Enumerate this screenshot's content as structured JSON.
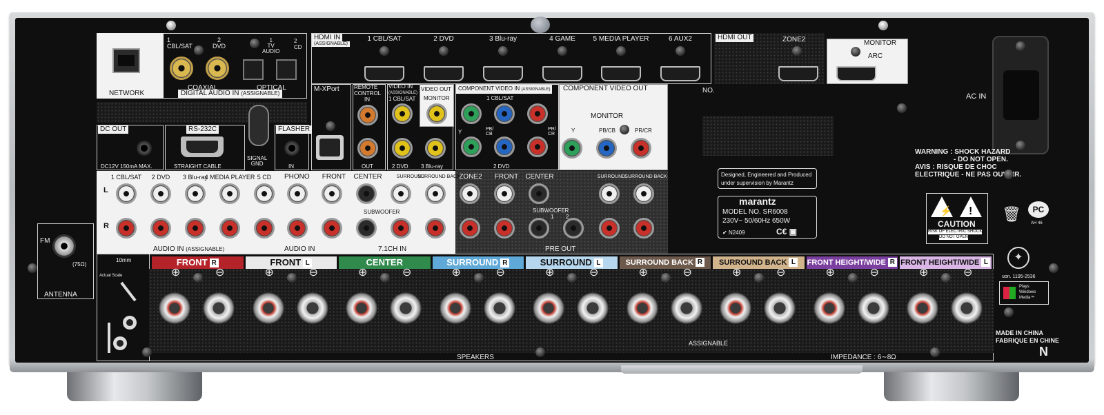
{
  "panel": {
    "network": "NETWORK",
    "digital_audio": {
      "coaxial_1": "1\nCBL/SAT",
      "coaxial_1_a": "1",
      "coaxial_1_b": "CBL/SAT",
      "coaxial_2_a": "2",
      "coaxial_2_b": "DVD",
      "optical_1_a": "1",
      "optical_1_b": "TV",
      "optical_1_c": "AUDIO",
      "optical_2_a": "2",
      "optical_2_b": "CD",
      "coaxial": "COAXIAL",
      "optical": "OPTICAL",
      "title": "DIGITAL AUDIO IN",
      "assignable": "(ASSIGNABLE)"
    },
    "hdmi_in": {
      "title": "HDMI IN",
      "assignable": "(ASSIGNABLE)",
      "inputs": [
        "1 CBL/SAT",
        "2 DVD",
        "3 Blu-ray",
        "4 GAME",
        "5 MEDIA PLAYER",
        "6 AUX2"
      ]
    },
    "hdmi_out": {
      "title": "HDMI OUT",
      "zone2": "ZONE2",
      "monitor": "MONITOR",
      "arc": "ARC",
      "no": "NO."
    },
    "ac_in": "AC IN",
    "m_xport": "M-XPort",
    "remote_control": {
      "title_a": "REMOTE",
      "title_b": "CONTROL",
      "in": "IN",
      "out": "OUT"
    },
    "video_in": {
      "title_a": "VIDEO IN",
      "title_b": "(ASSIGNABLE)",
      "cbl": "1 CBL/SAT",
      "dvd": "2 DVD",
      "bluray": "3 Blu-ray"
    },
    "video_out": {
      "title": "VIDEO OUT",
      "monitor": "MONITOR"
    },
    "component_in": {
      "title": "COMPONENT VIDEO IN",
      "assignable": "(ASSIGNABLE)",
      "cbl": "1 CBL/SAT",
      "dvd": "2 DVD",
      "y": "Y",
      "pb": "PB/\nCB",
      "pb_a": "PB/",
      "pb_b": "CB",
      "pr_a": "PR/",
      "pr_b": "CR"
    },
    "component_out": {
      "title": "COMPONENT VIDEO OUT",
      "monitor": "MONITOR",
      "y": "Y",
      "pb": "PB/CB",
      "pr": "PR/CR"
    },
    "dc_out": {
      "title": "DC OUT",
      "spec": "DC12V 150mA MAX."
    },
    "rs232c": {
      "title": "RS-232C",
      "cable": "STRAIGHT CABLE"
    },
    "signal_gnd_a": "SIGNAL",
    "signal_gnd_b": "GND",
    "flasher": {
      "title": "FLASHER",
      "in": "IN"
    },
    "audio_in": {
      "labels": [
        "1 CBL/SAT",
        "2 DVD",
        "3 Blu-ray",
        "4 MEDIA PLAYER",
        "5 CD"
      ],
      "title": "AUDIO IN",
      "assignable": "(ASSIGNABLE)",
      "l": "L",
      "r": "R"
    },
    "phono": {
      "title": "PHONO",
      "footer": "AUDIO IN"
    },
    "multi_in": {
      "labels": [
        "FRONT",
        "CENTER",
        "SURROUND",
        "SURROUND BACK"
      ],
      "subwoofer": "SUBWOOFER",
      "footer": "7.1CH IN"
    },
    "pre_out": {
      "labels": [
        "ZONE2",
        "FRONT",
        "CENTER",
        "SURROUND",
        "SURROUND BACK"
      ],
      "subwoofer": "SUBWOOFER",
      "sub_1": "1",
      "sub_2": "2",
      "footer": "PRE OUT"
    },
    "designed": {
      "line1": "Designed, Engineered and Produced",
      "line2": "under supervision by Marantz"
    },
    "model": {
      "brand": "marantz",
      "model": "MODEL NO. SR6008",
      "power": "230V~ 50/60Hz 650W",
      "cert": "N2409"
    },
    "warning": {
      "l1": "WARNING : SHOCK HAZARD",
      "l2": "- DO NOT OPEN.",
      "l3": "AVIS : RISQUE DE CHOC",
      "l4": "ELECTRIQUE - NE PAS OUVRIR."
    },
    "caution": {
      "title": "CAUTION",
      "l1": "RISK OF ELECTRIC SHOCK",
      "l2": "DO NOT OPEN"
    },
    "pct_small": "AH 46",
    "cert_number": "uon. 1195-2536",
    "windows": {
      "a": "Plays",
      "b": "Windows",
      "c": "Media™"
    },
    "made_in": {
      "l1": "MADE IN CHINA",
      "l2": "FABRIQUE EN CHINE"
    },
    "antenna": {
      "fm": "FM",
      "ohm": "(75Ω)",
      "title": "ANTENNA"
    },
    "scale": {
      "mm": "10mm",
      "actual": "Actual Scale"
    },
    "speakers": {
      "bands": [
        {
          "label": "FRONT",
          "ch": "R"
        },
        {
          "label": "FRONT",
          "ch": "L"
        },
        {
          "label": "CENTER",
          "ch": ""
        },
        {
          "label": "SURROUND",
          "ch": "R"
        },
        {
          "label": "SURROUND",
          "ch": "L"
        },
        {
          "label": "SURROUND BACK",
          "ch": "R"
        },
        {
          "label": "SURROUND BACK",
          "ch": "L"
        },
        {
          "label": "FRONT HEIGHT/WIDE",
          "ch": "R"
        },
        {
          "label": "FRONT HEIGHT/WIDE",
          "ch": "L"
        }
      ],
      "plus": "⊕",
      "minus": "⊖",
      "assignable": "ASSIGNABLE",
      "title": "SPEAKERS",
      "impedance": "IMPEDANCE : 6∼8Ω"
    },
    "region": "N"
  },
  "colors": {
    "front_r": "#b5232a",
    "front_l": "#e9e9e9",
    "center": "#2f8a4c",
    "surround_r": "#5fa9d9",
    "surround_l": "#b6d7ee",
    "surround_back_r": "#6e5a4d",
    "surround_back_l": "#d2b48c",
    "height_r": "#7b3fa0",
    "height_l": "#d9b6e6"
  }
}
